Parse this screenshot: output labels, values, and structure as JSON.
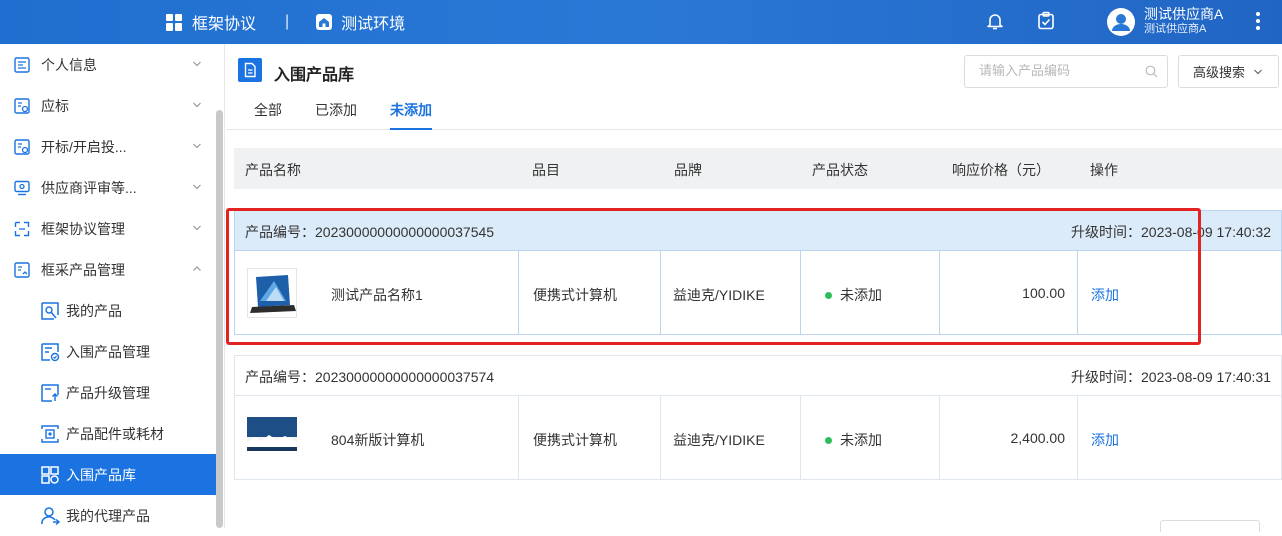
{
  "topbar": {
    "system_name": "框架协议",
    "separator": "|",
    "env_name": "测试环境",
    "user_name": "测试供应商A",
    "user_sub": "测试供应商A"
  },
  "sidebar": {
    "items": [
      {
        "label": "个人信息",
        "icon": "person-card-icon"
      },
      {
        "label": "应标",
        "icon": "bid-icon"
      },
      {
        "label": "开标/开启投...",
        "icon": "open-bid-icon"
      },
      {
        "label": "供应商评审等...",
        "icon": "review-monitor-icon"
      },
      {
        "label": "框架协议管理",
        "icon": "agreement-icon"
      },
      {
        "label": "框采产品管理",
        "icon": "product-manage-icon"
      }
    ],
    "sub_items": [
      {
        "label": "我的产品",
        "icon": "my-product-icon"
      },
      {
        "label": "入围产品管理",
        "icon": "shortlist-manage-icon"
      },
      {
        "label": "产品升级管理",
        "icon": "upgrade-icon"
      },
      {
        "label": "产品配件或耗材",
        "icon": "accessory-icon"
      },
      {
        "label": "入围产品库",
        "icon": "library-icon"
      },
      {
        "label": "我的代理产品",
        "icon": "agent-product-icon"
      }
    ]
  },
  "page": {
    "title": "入围产品库",
    "search_placeholder": "请输入产品编码",
    "advanced_search": "高级搜索"
  },
  "tabs": [
    {
      "label": "全部"
    },
    {
      "label": "已添加"
    },
    {
      "label": "未添加"
    }
  ],
  "table": {
    "columns": [
      "产品名称",
      "品目",
      "品牌",
      "产品状态",
      "响应价格（元）",
      "操作"
    ],
    "groups": [
      {
        "product_no": "产品编号：20230000000000000037545",
        "upgrade_time": "升级时间：2023-08-09 17:40:32",
        "name": "测试产品名称1",
        "category": "便携式计算机",
        "brand": "益迪克/YIDIKE",
        "status": "未添加",
        "price": "100.00",
        "action": "添加"
      },
      {
        "product_no": "产品编号：20230000000000000037574",
        "upgrade_time": "升级时间：2023-08-09 17:40:31",
        "name": "804新版计算机",
        "category": "便携式计算机",
        "brand": "益迪克/YIDIKE",
        "status": "未添加",
        "price": "2,400.00",
        "action": "添加"
      }
    ]
  },
  "colors": {
    "primary": "#1a73e0",
    "highlight_row": "#dcebf9",
    "status_dot": "#2ebd59",
    "annotation_box": "#e32222"
  }
}
